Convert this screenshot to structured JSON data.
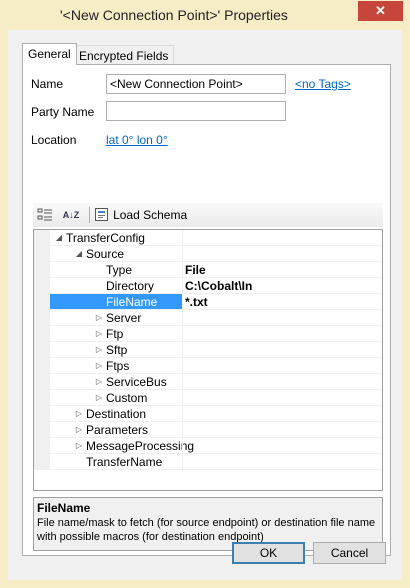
{
  "window": {
    "title": "'<New Connection Point>' Properties",
    "close_glyph": "✕"
  },
  "tabs": [
    {
      "label": "General",
      "active": true
    },
    {
      "label": "Encrypted Fields",
      "active": false
    }
  ],
  "general": {
    "name_label": "Name",
    "name_value": "<New Connection Point>",
    "tags_link": "<no Tags>",
    "party_label": "Party Name",
    "party_value": "",
    "location_label": "Location",
    "location_link": "lat 0°  lon 0°"
  },
  "toolbar": {
    "categorized_icon": "categorized-icon",
    "alpha_icon": "alphabetical-sort-icon",
    "alpha_glyph": "A↓Z",
    "load_schema_label": "Load Schema"
  },
  "grid": {
    "rows": [
      {
        "name": "TransferConfig",
        "indent": 0,
        "expander": "open",
        "value": ""
      },
      {
        "name": "Source",
        "indent": 1,
        "expander": "open",
        "value": ""
      },
      {
        "name": "Type",
        "indent": 2,
        "expander": "none",
        "value": "File"
      },
      {
        "name": "Directory",
        "indent": 2,
        "expander": "none",
        "value": "C:\\Cobalt\\In"
      },
      {
        "name": "FileName",
        "indent": 2,
        "expander": "none",
        "value": "*.txt",
        "selected": true
      },
      {
        "name": "Server",
        "indent": 2,
        "expander": "closed",
        "value": ""
      },
      {
        "name": "Ftp",
        "indent": 2,
        "expander": "closed",
        "value": ""
      },
      {
        "name": "Sftp",
        "indent": 2,
        "expander": "closed",
        "value": ""
      },
      {
        "name": "Ftps",
        "indent": 2,
        "expander": "closed",
        "value": ""
      },
      {
        "name": "ServiceBus",
        "indent": 2,
        "expander": "closed",
        "value": ""
      },
      {
        "name": "Custom",
        "indent": 2,
        "expander": "closed",
        "value": ""
      },
      {
        "name": "Destination",
        "indent": 1,
        "expander": "closed",
        "value": ""
      },
      {
        "name": "Parameters",
        "indent": 1,
        "expander": "closed",
        "value": ""
      },
      {
        "name": "MessageProcessing",
        "indent": 1,
        "expander": "closed",
        "value": ""
      },
      {
        "name": "TransferName",
        "indent": 1,
        "expander": "none",
        "value": ""
      }
    ]
  },
  "description": {
    "title": "FileName",
    "text": "File name/mask to fetch (for source endpoint) or destination file name with possible macros (for destination endpoint)"
  },
  "buttons": {
    "ok": "OK",
    "cancel": "Cancel"
  },
  "colors": {
    "frame": "#f6ecc6",
    "close": "#c7463c",
    "selection": "#3399ff",
    "link": "#0066cc"
  }
}
